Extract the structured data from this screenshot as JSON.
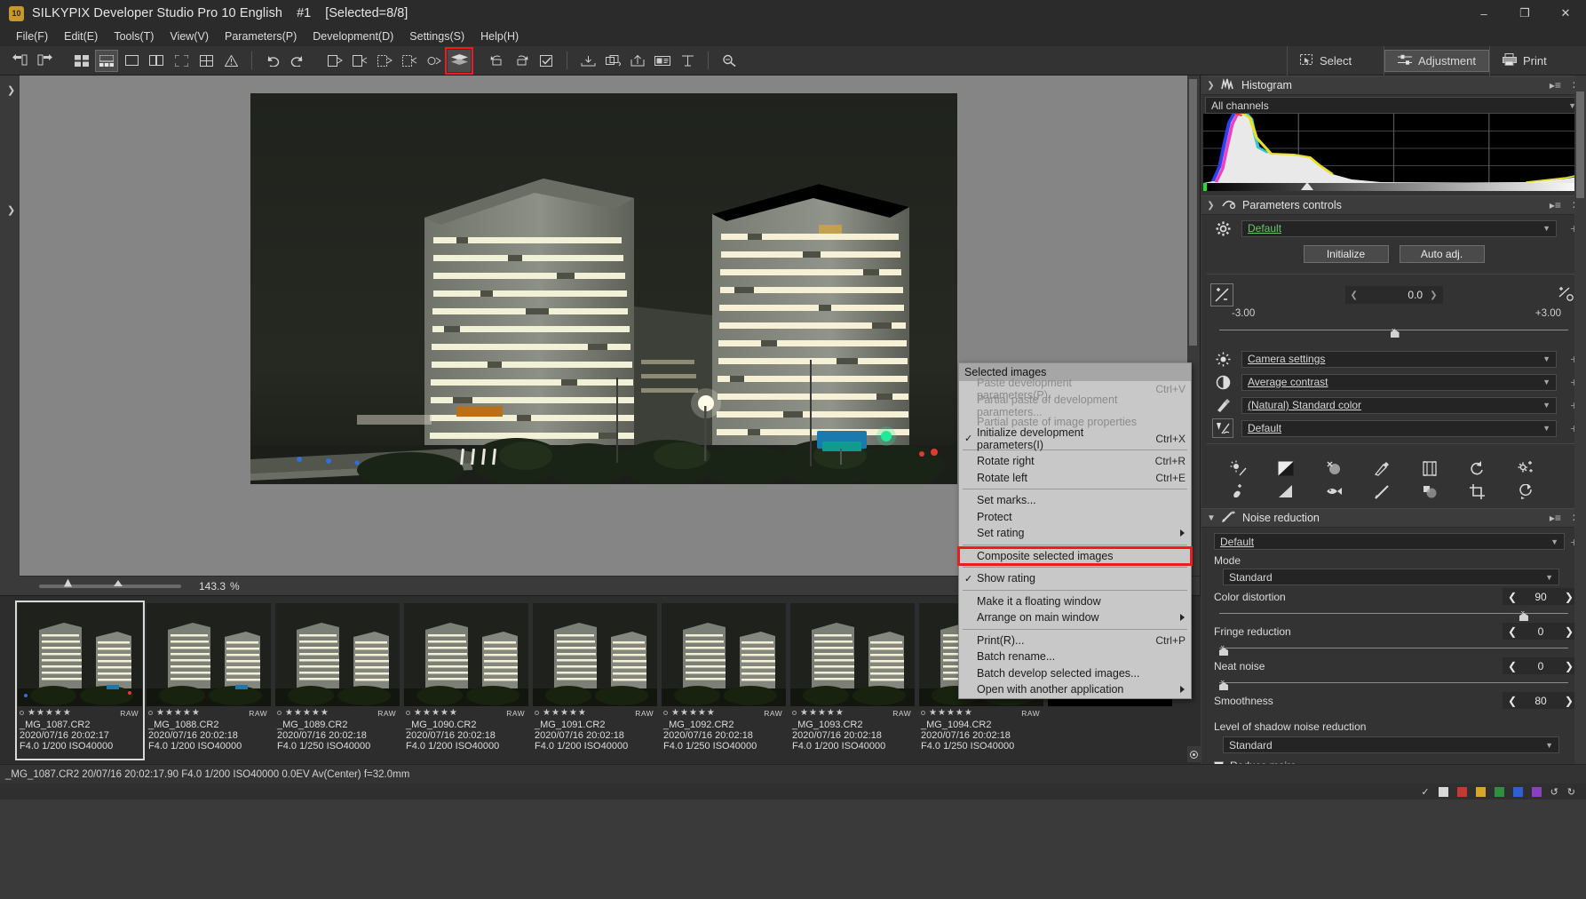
{
  "window": {
    "app_icon_text": "10",
    "title": "SILKYPIX Developer Studio Pro 10 English",
    "instance": "#1",
    "selection": "[Selected=8/8]",
    "minimize": "–",
    "maximize": "❐",
    "close": "✕"
  },
  "menubar": {
    "items": [
      {
        "label": "File(F)"
      },
      {
        "label": "Edit(E)"
      },
      {
        "label": "Tools(T)"
      },
      {
        "label": "View(V)"
      },
      {
        "label": "Parameters(P)"
      },
      {
        "label": "Development(D)"
      },
      {
        "label": "Settings(S)"
      },
      {
        "label": "Help(H)"
      }
    ]
  },
  "toolbar": {
    "modes": [
      {
        "label": "Select",
        "icon": "select-icon"
      },
      {
        "label": "Adjustment",
        "icon": "adjustment-icon"
      },
      {
        "label": "Print",
        "icon": "print-icon"
      }
    ]
  },
  "preview": {
    "zoom_value": "143.3",
    "zoom_unit": "%"
  },
  "context_menu": {
    "header": "Selected images",
    "items": [
      {
        "label": "Paste development parameters(P)",
        "shortcut": "Ctrl+V",
        "disabled": true,
        "checked": false,
        "submenu": false
      },
      {
        "label": "Partial paste of development parameters...",
        "shortcut": "",
        "disabled": true,
        "checked": false,
        "submenu": false
      },
      {
        "label": "Partial paste of image properties",
        "shortcut": "",
        "disabled": true,
        "checked": false,
        "submenu": false
      },
      {
        "label": "Initialize development parameters(I)",
        "shortcut": "Ctrl+X",
        "disabled": false,
        "checked": true,
        "submenu": false
      },
      {
        "separator": true
      },
      {
        "label": "Rotate right",
        "shortcut": "Ctrl+R",
        "disabled": false,
        "checked": false,
        "submenu": false
      },
      {
        "label": "Rotate left",
        "shortcut": "Ctrl+E",
        "disabled": false,
        "checked": false,
        "submenu": false
      },
      {
        "separator": true
      },
      {
        "label": "Set marks...",
        "shortcut": "",
        "disabled": false,
        "checked": false,
        "submenu": false
      },
      {
        "label": "Protect",
        "shortcut": "",
        "disabled": false,
        "checked": false,
        "submenu": false
      },
      {
        "label": "Set rating",
        "shortcut": "",
        "disabled": false,
        "checked": false,
        "submenu": true
      },
      {
        "separator": true
      },
      {
        "label": "Composite selected images",
        "shortcut": "",
        "disabled": false,
        "checked": false,
        "submenu": false,
        "highlighted": true
      },
      {
        "separator": true
      },
      {
        "label": "Show rating",
        "shortcut": "",
        "disabled": false,
        "checked": true,
        "submenu": false
      },
      {
        "separator": true
      },
      {
        "label": "Make it a floating window",
        "shortcut": "",
        "disabled": false,
        "checked": false,
        "submenu": false
      },
      {
        "label": "Arrange on main window",
        "shortcut": "",
        "disabled": false,
        "checked": false,
        "submenu": true
      },
      {
        "separator": true
      },
      {
        "label": "Print(R)...",
        "shortcut": "Ctrl+P",
        "disabled": false,
        "checked": false,
        "submenu": false
      },
      {
        "label": "Batch rename...",
        "shortcut": "",
        "disabled": false,
        "checked": false,
        "submenu": false
      },
      {
        "label": "Batch develop selected images...",
        "shortcut": "",
        "disabled": false,
        "checked": false,
        "submenu": false
      },
      {
        "label": "Open with another application",
        "shortcut": "",
        "disabled": false,
        "checked": false,
        "submenu": true
      }
    ]
  },
  "filmstrip": {
    "thumbnails": [
      {
        "filename": "_MG_1087.CR2",
        "datetime": "2020/07/16 20:02:17",
        "exposure": "F4.0 1/200 ISO40000",
        "badge": "RAW",
        "stars": 5,
        "selected": true
      },
      {
        "filename": "_MG_1088.CR2",
        "datetime": "2020/07/16 20:02:18",
        "exposure": "F4.0 1/200 ISO40000",
        "badge": "RAW",
        "stars": 5,
        "selected": false
      },
      {
        "filename": "_MG_1089.CR2",
        "datetime": "2020/07/16 20:02:18",
        "exposure": "F4.0 1/250 ISO40000",
        "badge": "RAW",
        "stars": 5,
        "selected": false
      },
      {
        "filename": "_MG_1090.CR2",
        "datetime": "2020/07/16 20:02:18",
        "exposure": "F4.0 1/200 ISO40000",
        "badge": "RAW",
        "stars": 5,
        "selected": false
      },
      {
        "filename": "_MG_1091.CR2",
        "datetime": "2020/07/16 20:02:18",
        "exposure": "F4.0 1/200 ISO40000",
        "badge": "RAW",
        "stars": 5,
        "selected": false
      },
      {
        "filename": "_MG_1092.CR2",
        "datetime": "2020/07/16 20:02:18",
        "exposure": "F4.0 1/250 ISO40000",
        "badge": "RAW",
        "stars": 5,
        "selected": false
      },
      {
        "filename": "_MG_1093.CR2",
        "datetime": "2020/07/16 20:02:18",
        "exposure": "F4.0 1/200 ISO40000",
        "badge": "RAW",
        "stars": 5,
        "selected": false
      },
      {
        "filename": "_MG_1094.CR2",
        "datetime": "2020/07/16 20:02:18",
        "exposure": "F4.0 1/250 ISO40000",
        "badge": "RAW",
        "stars": 5,
        "selected": false
      }
    ]
  },
  "right_panel": {
    "histogram": {
      "title": "Histogram",
      "channel_select": "All channels"
    },
    "parameters_controls": {
      "title": "Parameters controls",
      "preset": "Default",
      "initialize_button": "Initialize",
      "auto_adj_button": "Auto adj.",
      "exposure_value": "0.0",
      "exposure_min": "-3.00",
      "exposure_max": "+3.00",
      "white_balance": "Camera settings",
      "tone": "Average contrast",
      "color": "(Natural) Standard color",
      "sharpness": "Default"
    },
    "noise_reduction": {
      "title": "Noise reduction",
      "preset": "Default",
      "mode_label": "Mode",
      "mode_value": "Standard",
      "color_distortion_label": "Color distortion",
      "color_distortion_value": "90",
      "fringe_reduction_label": "Fringe reduction",
      "fringe_reduction_value": "0",
      "neat_noise_label": "Neat noise",
      "neat_noise_value": "0",
      "smoothness_label": "Smoothness",
      "smoothness_value": "80",
      "shadow_nr_label": "Level of shadow noise reduction",
      "shadow_nr_value": "Standard",
      "reduce_moire_label": "Reduce moire"
    }
  },
  "statusbar": {
    "text": "_MG_1087.CR2 20/07/16 20:02:17.90 F4.0 1/200 ISO40000  0.0EV Av(Center) f=32.0mm"
  },
  "colors": {
    "accent_red": "#ee1c1c",
    "link_green": "#69c36b",
    "panel_bg": "#333333",
    "titlebar_bg": "#2b2b2b",
    "menu_bg": "#c8c8c8"
  }
}
